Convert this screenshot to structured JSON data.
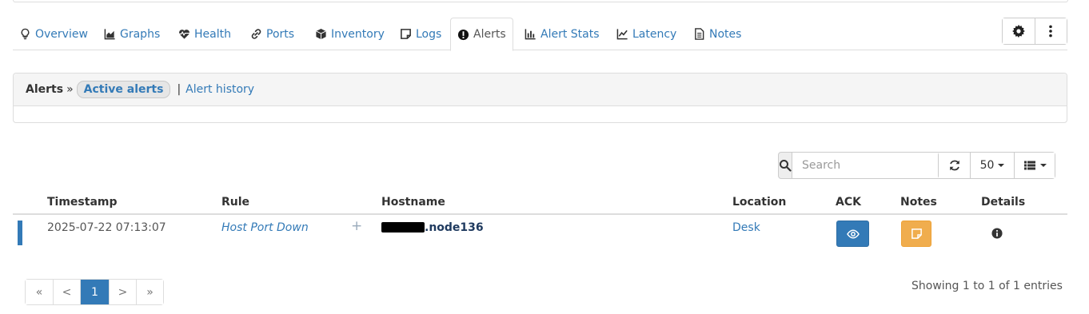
{
  "tabs": [
    {
      "label": "Overview",
      "icon": "lightbulb-icon"
    },
    {
      "label": "Graphs",
      "icon": "area-chart-icon"
    },
    {
      "label": "Health",
      "icon": "heartbeat-icon"
    },
    {
      "label": "Ports",
      "icon": "link-icon"
    },
    {
      "label": "Inventory",
      "icon": "cube-icon"
    },
    {
      "label": "Logs",
      "icon": "note-icon"
    },
    {
      "label": "Alerts",
      "icon": "exclamation-circle-icon",
      "active": true
    },
    {
      "label": "Alert Stats",
      "icon": "bar-chart-icon"
    },
    {
      "label": "Latency",
      "icon": "line-chart-icon"
    },
    {
      "label": "Notes",
      "icon": "file-text-icon"
    }
  ],
  "toolbar": {
    "settings_icon": "gear-icon",
    "menu_icon": "vertical-ellipsis-icon"
  },
  "breadcrumb": {
    "root": "Alerts",
    "separator": "»",
    "active": "Active alerts",
    "pipe": "|",
    "other": "Alert history"
  },
  "search": {
    "placeholder": "Search",
    "value": ""
  },
  "table_controls": {
    "page_size": "50"
  },
  "table": {
    "columns": [
      "Timestamp",
      "Rule",
      "Hostname",
      "Location",
      "ACK",
      "Notes",
      "Details"
    ],
    "rows": [
      {
        "timestamp": "2025-07-22 07:13:07",
        "rule": "Host Port Down",
        "plus": "+",
        "hostname_suffix": ".node136",
        "location": "Desk",
        "severity_color": "#337ab7"
      }
    ]
  },
  "pagination": {
    "first": "«",
    "prev": "<",
    "current": "1",
    "next": ">",
    "last": "»"
  },
  "status": {
    "showing": "Showing 1 to 1 of 1 entries"
  },
  "colors": {
    "primary": "#337ab7",
    "warning": "#f0ad4e"
  }
}
